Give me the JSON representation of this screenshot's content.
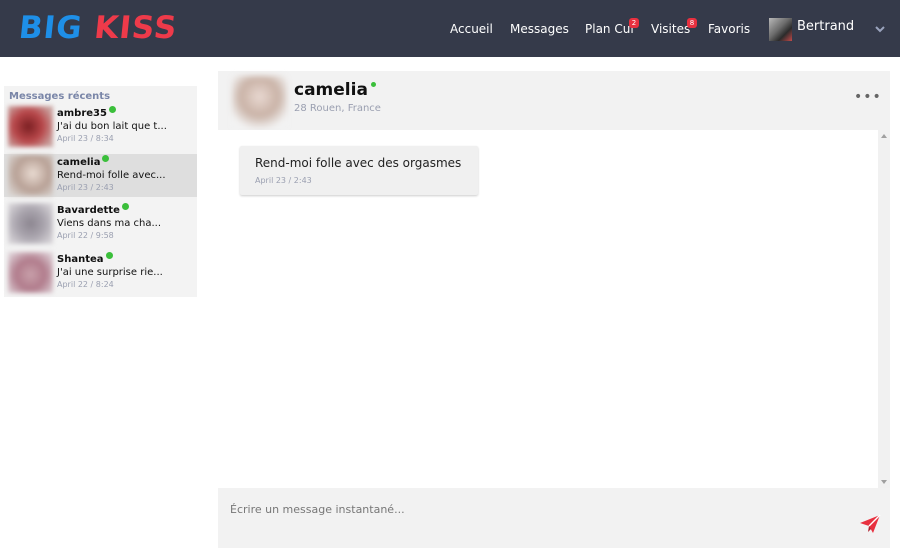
{
  "brand": {
    "logo_big": "BIG",
    "logo_kiss": "KISS",
    "accent_blue": "#1e8fe8",
    "accent_red": "#ee3a4a"
  },
  "nav": {
    "home": "Accueil",
    "messages": "Messages",
    "plan_cul": "Plan Cul",
    "plan_cul_badge": "2",
    "visites": "Visites",
    "visites_badge": "8",
    "favoris": "Favoris"
  },
  "user": {
    "name": "Bertrand"
  },
  "sidebar": {
    "title": "Messages récents",
    "conversations": [
      {
        "name": "ambre35",
        "preview": "J'ai du bon lait que t...",
        "time": "April 23 / 8:34",
        "online": true
      },
      {
        "name": "camelia",
        "preview": "Rend-moi folle avec...",
        "time": "April 23 / 2:43",
        "online": true,
        "active": true
      },
      {
        "name": "Bavardette",
        "preview": "Viens dans ma cha...",
        "time": "April 22 / 9:58",
        "online": true
      },
      {
        "name": "Shantea",
        "preview": "J'ai une surprise rie...",
        "time": "April 22 / 8:24",
        "online": true
      }
    ]
  },
  "chat": {
    "name": "camelia",
    "location": "28 Rouen, France",
    "menu_icon": "more-horizontal-icon",
    "menu_glyph": "•••",
    "messages": [
      {
        "text": "Rend-moi folle avec des orgasmes",
        "time": "April 23 / 2:43"
      }
    ],
    "composer_placeholder": "Écrire un message instantané..."
  }
}
